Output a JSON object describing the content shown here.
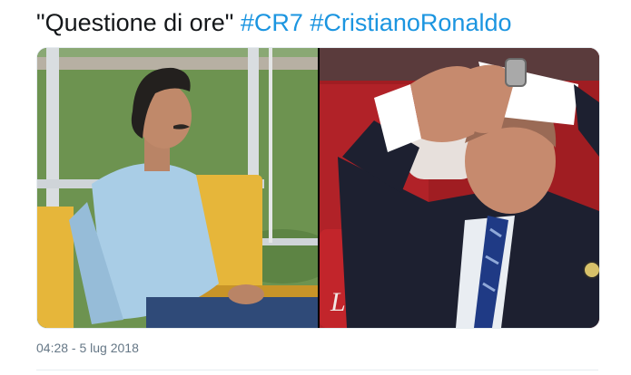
{
  "tweet": {
    "text_quote": "\"Questione di ore\"",
    "hashtags": [
      "#CR7",
      "#CristianoRonaldo"
    ],
    "timestamp": "04:28 - 5 lug 2018"
  },
  "media": {
    "photos": [
      {
        "name": "man-waiting-on-bench"
      },
      {
        "name": "man-gesturing-in-suit"
      }
    ]
  },
  "colors": {
    "text": "#14171a",
    "hashtag": "#1b95e0",
    "meta": "#657786",
    "border": "#e6ecf0"
  }
}
